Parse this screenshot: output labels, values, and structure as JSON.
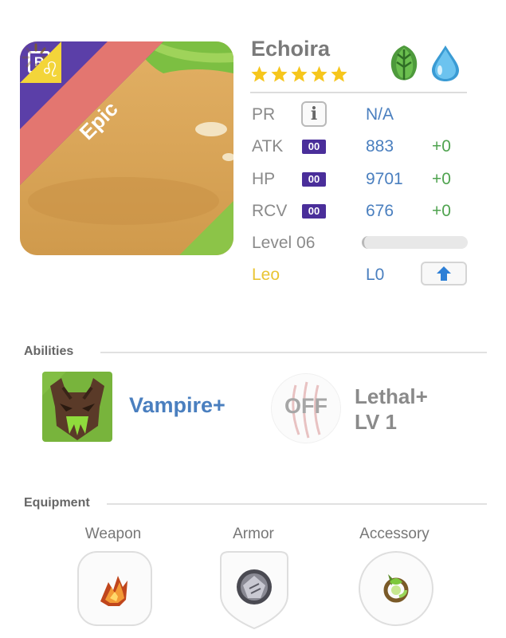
{
  "hero": {
    "name": "Echoira",
    "rarity": "Epic",
    "rank_badge": "R",
    "stars": 5,
    "elements": [
      "leaf-element-icon",
      "water-element-icon"
    ],
    "zodiac": "Leo",
    "zodiac_symbol": "♌"
  },
  "stats": {
    "pr_label": "PR",
    "pr_value": "N/A",
    "info_glyph": "i",
    "atk_label": "ATK",
    "atk_badge": "00",
    "atk_value": "883",
    "atk_plus": "+0",
    "hp_label": "HP",
    "hp_badge": "00",
    "hp_value": "9701",
    "hp_plus": "+0",
    "rcv_label": "RCV",
    "rcv_badge": "00",
    "rcv_value": "676",
    "rcv_plus": "+0",
    "level_label": "Level 06",
    "level_progress": 0.02,
    "zodiac_level": "L0"
  },
  "abilities": {
    "title": "Abilities",
    "primary_name": "Vampire+",
    "secondary_state": "OFF",
    "secondary_name": "Lethal+",
    "secondary_level": "LV 1"
  },
  "equipment": {
    "title": "Equipment",
    "weapon_label": "Weapon",
    "armor_label": "Armor",
    "accessory_label": "Accessory"
  },
  "colors": {
    "stat_value": "#4a7fbf",
    "stat_bonus": "#4fa34f",
    "zodiac": "#e9c534",
    "rarity_banner": "#e37670",
    "rank_triangle": "#5b3fa8"
  }
}
